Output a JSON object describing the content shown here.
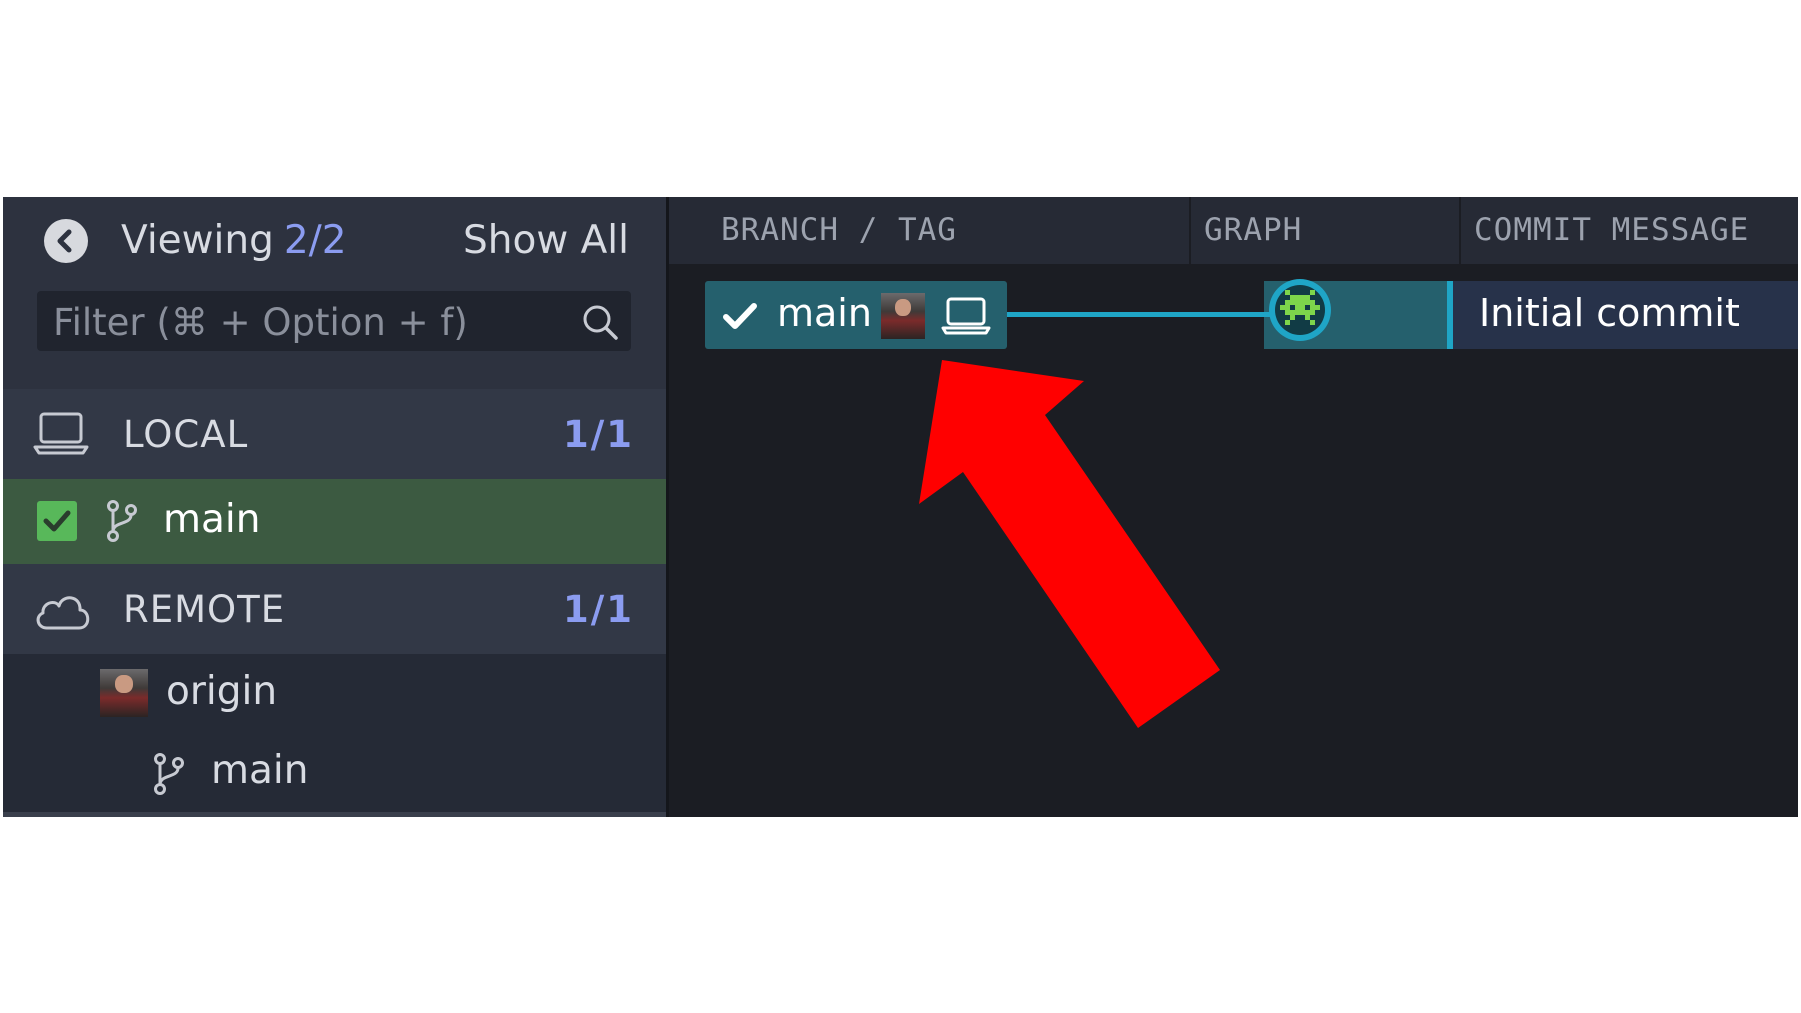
{
  "sidebar": {
    "viewing_label": "Viewing",
    "viewing_count": "2/2",
    "show_all_label": "Show All",
    "filter_placeholder": "Filter (⌘ + Option + f)",
    "local": {
      "label": "LOCAL",
      "count": "1/1",
      "branch": "main"
    },
    "remote": {
      "label": "REMOTE",
      "count": "1/1",
      "origin": "origin",
      "branch": "main"
    }
  },
  "graph": {
    "columns": [
      "BRANCH / TAG",
      "GRAPH",
      "COMMIT MESSAGE"
    ],
    "branch_label": "main",
    "commit_message": "Initial commit"
  },
  "colors": {
    "accent": "#1fa5c6",
    "selected_branch_bg": "#3c5a41",
    "count_color": "#8b9cf0",
    "annotation_arrow": "#ff0000"
  },
  "icons": [
    "back-icon",
    "search-icon",
    "laptop-icon",
    "cloud-icon",
    "branch-icon",
    "check-icon",
    "avatar",
    "commit-node-icon",
    "red-arrow"
  ]
}
